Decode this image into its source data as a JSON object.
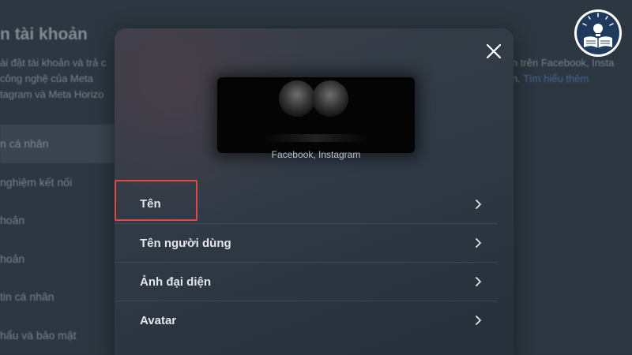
{
  "background": {
    "title": "n tài khoản",
    "description": "ài đặt tài khoản và trả c công nghệ của Meta tagram và Meta Horizo",
    "right_text_1": "n trên Facebook, Insta",
    "right_text_2": "n.",
    "right_link": "Tìm hiểu thêm",
    "nav_items": [
      {
        "label": "n cá nhân",
        "active": true
      },
      {
        "label": "nghiệm kết nối",
        "active": false
      },
      {
        "label": "hoản",
        "active": false
      },
      {
        "label": "hoản",
        "active": false
      },
      {
        "label": "tin cá nhân",
        "active": false
      },
      {
        "label": "hẩu và bảo mật",
        "active": false
      }
    ]
  },
  "modal": {
    "close_icon": "close-icon",
    "account_platforms": "Facebook, Instagram",
    "rows": [
      {
        "label": "Tên",
        "icon": "chevron-right-icon"
      },
      {
        "label": "Tên người dùng",
        "icon": "chevron-right-icon"
      },
      {
        "label": "Ảnh đại diện",
        "icon": "chevron-right-icon"
      },
      {
        "label": "Avatar",
        "icon": "chevron-right-icon"
      }
    ],
    "highlighted_row": 0
  },
  "colors": {
    "highlight": "#e04848",
    "modal_background": "#2f3a45",
    "page_background": "#2c3741",
    "text": "#e4e6eb"
  },
  "watermark": {
    "icon": "book-lightbulb-logo"
  }
}
